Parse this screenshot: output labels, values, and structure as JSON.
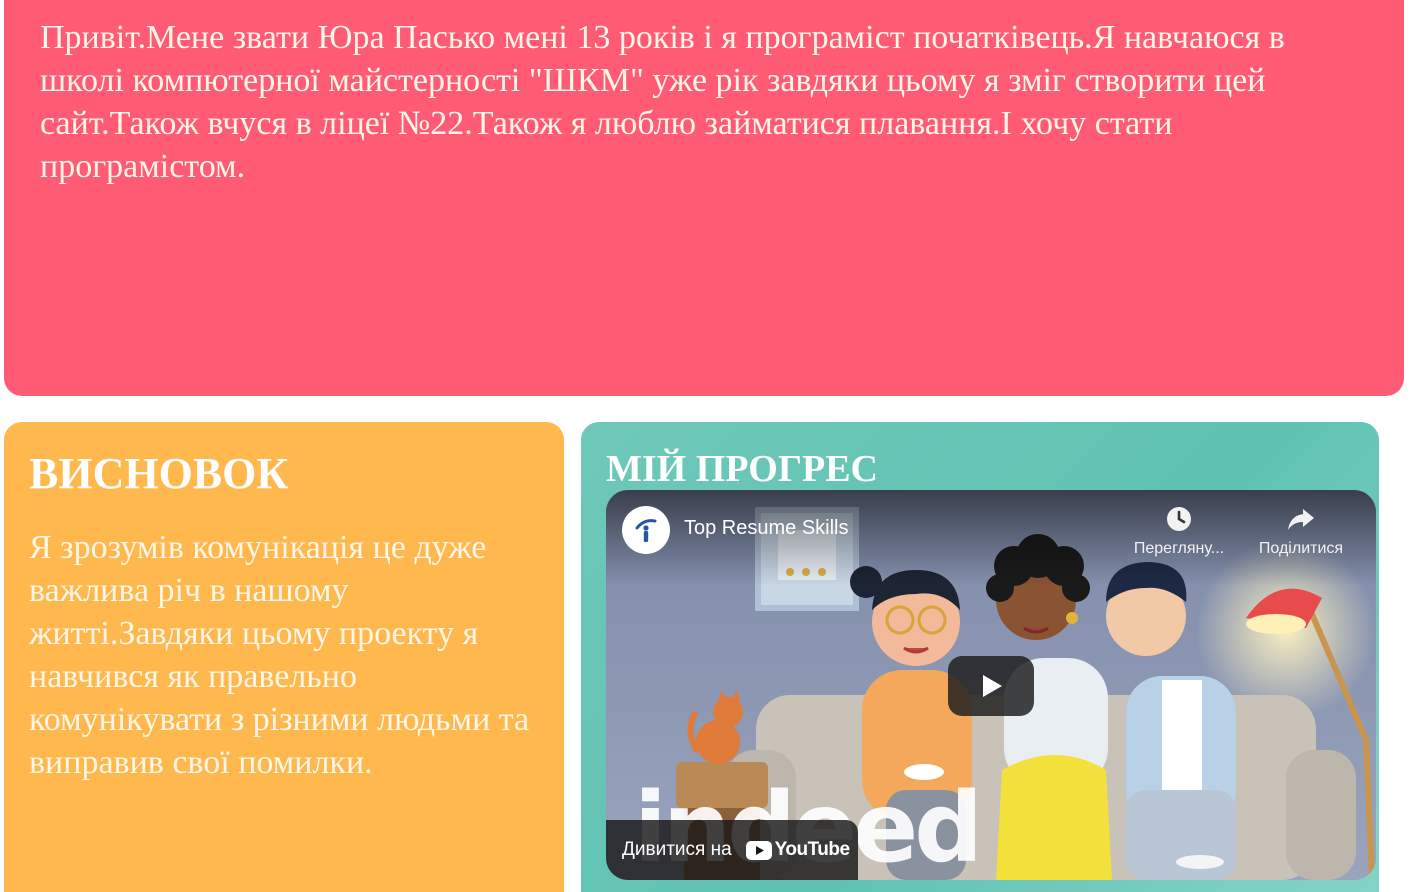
{
  "about": {
    "text": "Привіт.Мене звати Юра Пасько мені 13 років і я програміст початківець.Я навчаюся в школі компютерної майстерності \"ШКМ\" уже рік завдяки цьому я зміг створити цей сайт.Також вчуся в ліцеї №22.Також я люблю займатися плавання.І хочу стати програмістом."
  },
  "conclusion": {
    "title": "ВИСНОВОК",
    "text": "Я зрозумів комунікація це дуже важлива річ в нашому житті.Завдяки цьому проекту я навчився як правельно комунікувати з різними людьми та виправив свої помилки."
  },
  "progress": {
    "title": "МІЙ ПРОГРЕС",
    "video": {
      "title": "Top Resume Skills",
      "watch_later_label": "Перегляну...",
      "share_label": "Поділитися",
      "watch_on_label": "Дивитися на",
      "youtube_label": "YouTube",
      "watermark": "indeed"
    }
  },
  "colors": {
    "about_bg": "#ff5b74",
    "conclusion_bg": "#ffb84d",
    "progress_bg": "#6ec8b8"
  }
}
